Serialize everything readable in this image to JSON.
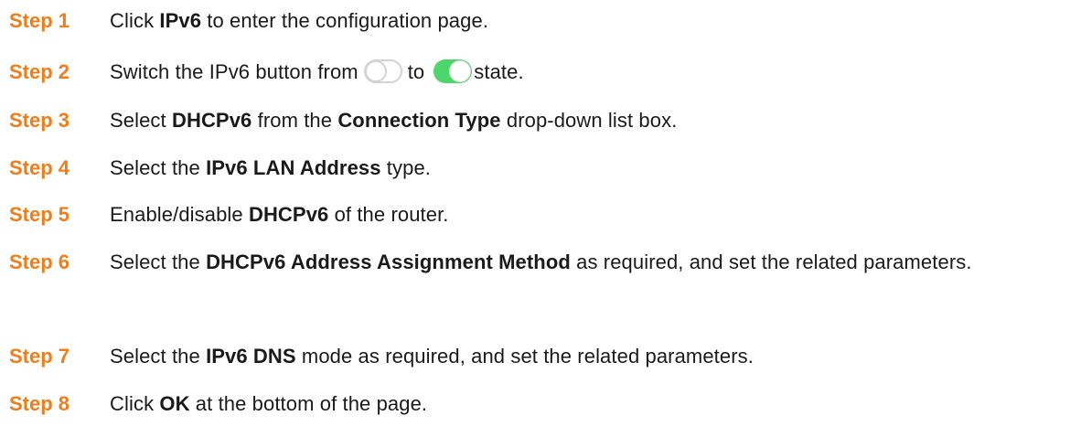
{
  "steps": [
    {
      "label": "Step 1",
      "parts": {
        "a": "Click ",
        "b": "IPv6",
        "c": " to enter the configuration page."
      }
    },
    {
      "label": "Step 2",
      "parts": {
        "a": "Switch the IPv6 button from",
        "b": "to",
        "c": "state."
      },
      "toggle_off_state": "off",
      "toggle_on_state": "on",
      "toggle_on_color": "#4cd66c"
    },
    {
      "label": "Step 3",
      "parts": {
        "a": "Select ",
        "b": "DHCPv6",
        "c": " from the ",
        "d": "Connection Type",
        "e": " drop-down list box."
      }
    },
    {
      "label": "Step 4",
      "parts": {
        "a": "Select the ",
        "b": "IPv6 LAN Address",
        "c": " type."
      }
    },
    {
      "label": "Step 5",
      "parts": {
        "a": "Enable/disable ",
        "b": "DHCPv6",
        "c": " of the router."
      }
    },
    {
      "label": "Step 6",
      "parts": {
        "a": "Select the ",
        "b": "DHCPv6 Address Assignment Method",
        "c": " as required, and set the related parameters."
      }
    },
    {
      "label": "Step 7",
      "parts": {
        "a": "Select the ",
        "b": "IPv6 DNS",
        "c": " mode as required, and set the related parameters."
      }
    },
    {
      "label": "Step 8",
      "parts": {
        "a": "Click ",
        "b": "OK",
        "c": " at the bottom of the page."
      }
    }
  ],
  "colors": {
    "step_label": "#ee7d1a",
    "text": "#1a1a1a"
  }
}
